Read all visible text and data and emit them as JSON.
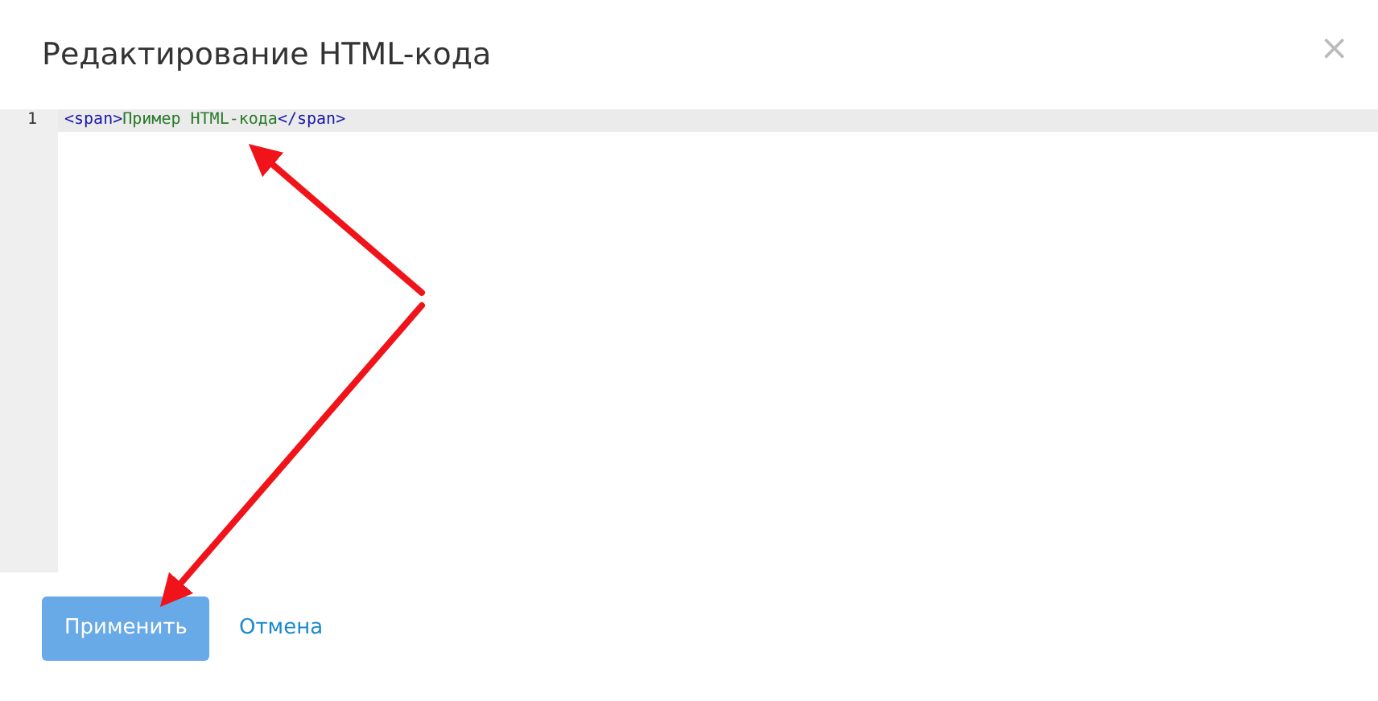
{
  "dialog": {
    "title": "Редактирование HTML-кода",
    "close": "×"
  },
  "editor": {
    "lines": [
      {
        "number": "1",
        "active": true,
        "tokens": [
          {
            "kind": "tag",
            "text": "<span>"
          },
          {
            "kind": "text",
            "text": "Пример HTML-кода"
          },
          {
            "kind": "tag",
            "text": "</span>"
          }
        ]
      }
    ]
  },
  "buttons": [
    {
      "kind": "primary",
      "label": "Применить"
    },
    {
      "kind": "link",
      "label": "Отмена"
    }
  ]
}
